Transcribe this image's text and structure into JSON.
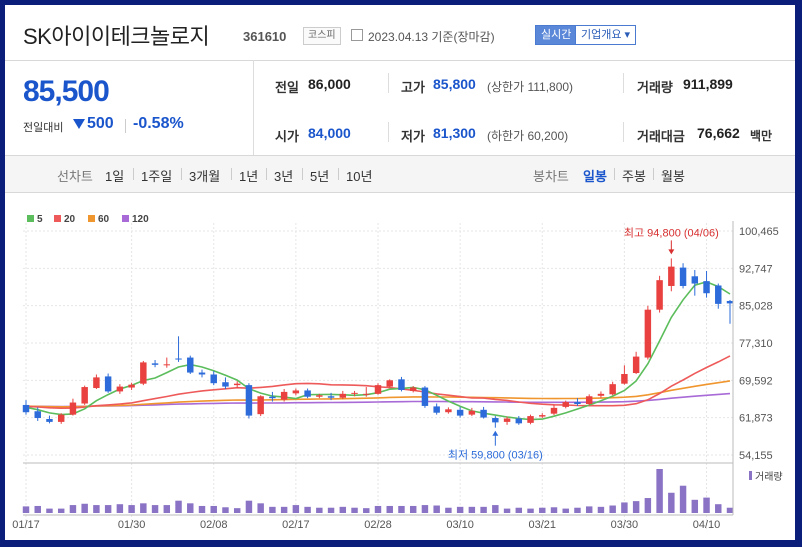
{
  "header": {
    "name": "SK아이이테크놀로지",
    "code": "361610",
    "market_badge": "코스피",
    "date": "2023.04.13 기준(장마감)",
    "realtime_button": "실시간",
    "company_button": "기업개요",
    "company_button_arrow": "▾"
  },
  "quote": {
    "price": "85,500",
    "change_label": "전일대비",
    "change": "500",
    "change_pct": "-0.58%",
    "prev_label": "전일",
    "prev": "86,000",
    "open_label": "시가",
    "open": "84,000",
    "high_label": "고가",
    "high": "85,800",
    "upper_limit": "(상한가 111,800)",
    "low_label": "저가",
    "low": "81,300",
    "lower_limit": "(하한가 60,200)",
    "volume_label": "거래량",
    "volume": "911,899",
    "amount_label": "거래대금",
    "amount": "76,662",
    "amount_unit": "백만"
  },
  "tabs": {
    "line_chart": "선차트",
    "periods": [
      "1일",
      "1주일",
      "3개월",
      "1년",
      "3년",
      "5년",
      "10년"
    ],
    "candle_chart": "봉차트",
    "candle_periods": [
      "일봉",
      "주봉",
      "월봉"
    ],
    "active_candle": "일봉"
  },
  "colors": {
    "up": "#e8413f",
    "down": "#2c6bd9",
    "ma5": "#5bbd5b",
    "ma20": "#ee5a5a",
    "ma60": "#f0962e",
    "ma120": "#a86ad6",
    "volume": "#8a72c4"
  },
  "chart_data": {
    "type": "candlestick",
    "legend": [
      {
        "name": "5",
        "color": "#5bbd5b"
      },
      {
        "name": "20",
        "color": "#ee5a5a"
      },
      {
        "name": "60",
        "color": "#f0962e"
      },
      {
        "name": "120",
        "color": "#a86ad6"
      }
    ],
    "y_ticks": [
      "100,465",
      "92,747",
      "85,028",
      "77,310",
      "69,592",
      "61,873",
      "54,155"
    ],
    "ylim": [
      54155,
      100465
    ],
    "x_ticks": [
      {
        "i": 0,
        "label": "01/17"
      },
      {
        "i": 9,
        "label": "01/30"
      },
      {
        "i": 16,
        "label": "02/08"
      },
      {
        "i": 23,
        "label": "02/17"
      },
      {
        "i": 30,
        "label": "02/28"
      },
      {
        "i": 37,
        "label": "03/10"
      },
      {
        "i": 44,
        "label": "03/21"
      },
      {
        "i": 51,
        "label": "03/30"
      },
      {
        "i": 58,
        "label": "04/10"
      }
    ],
    "annotations": {
      "high": "최고 94,800 (04/06)",
      "high_index": 55,
      "high_value": 94800,
      "low": "최저 59,800 (03/16)",
      "low_index": 40,
      "low_value": 59800
    },
    "volume_label": "거래량",
    "candles": [
      {
        "o": 64500,
        "h": 65500,
        "c": 63000,
        "l": 62500
      },
      {
        "o": 63200,
        "h": 64000,
        "c": 61800,
        "l": 61200
      },
      {
        "o": 61600,
        "h": 62300,
        "c": 61000,
        "l": 60700
      },
      {
        "o": 61000,
        "h": 62800,
        "c": 62500,
        "l": 60600
      },
      {
        "o": 62500,
        "h": 65800,
        "c": 65000,
        "l": 62300
      },
      {
        "o": 64800,
        "h": 68500,
        "c": 68200,
        "l": 64500
      },
      {
        "o": 68000,
        "h": 70800,
        "c": 70200,
        "l": 67800
      },
      {
        "o": 70400,
        "h": 71000,
        "c": 67300,
        "l": 67000
      },
      {
        "o": 67300,
        "h": 68800,
        "c": 68300,
        "l": 66800
      },
      {
        "o": 68100,
        "h": 69100,
        "c": 68700,
        "l": 67600
      },
      {
        "o": 68900,
        "h": 73600,
        "c": 73300,
        "l": 68600
      },
      {
        "o": 73100,
        "h": 73800,
        "c": 72800,
        "l": 72300
      },
      {
        "o": 72700,
        "h": 74300,
        "c": 72900,
        "l": 72200
      },
      {
        "o": 74100,
        "h": 78700,
        "c": 74000,
        "l": 73400
      },
      {
        "o": 74300,
        "h": 74700,
        "c": 71200,
        "l": 70900
      },
      {
        "o": 71200,
        "h": 71800,
        "c": 70800,
        "l": 70200
      },
      {
        "o": 70800,
        "h": 71500,
        "c": 69000,
        "l": 68600
      },
      {
        "o": 69200,
        "h": 70200,
        "c": 68300,
        "l": 67800
      },
      {
        "o": 68600,
        "h": 69400,
        "c": 68900,
        "l": 68000
      },
      {
        "o": 68600,
        "h": 69000,
        "c": 62300,
        "l": 61700
      },
      {
        "o": 62600,
        "h": 66500,
        "c": 66300,
        "l": 62200
      },
      {
        "o": 66200,
        "h": 67200,
        "c": 65900,
        "l": 65200
      },
      {
        "o": 65600,
        "h": 67800,
        "c": 67200,
        "l": 65200
      },
      {
        "o": 66900,
        "h": 67900,
        "c": 67500,
        "l": 66500
      },
      {
        "o": 67500,
        "h": 67900,
        "c": 66200,
        "l": 65900
      },
      {
        "o": 66200,
        "h": 66800,
        "c": 66500,
        "l": 65900
      },
      {
        "o": 66300,
        "h": 67000,
        "c": 66000,
        "l": 65500
      },
      {
        "o": 66000,
        "h": 67400,
        "c": 66800,
        "l": 65700
      },
      {
        "o": 66800,
        "h": 67400,
        "c": 67000,
        "l": 66300
      },
      {
        "o": 66800,
        "h": 68200,
        "c": 66800,
        "l": 66200
      },
      {
        "o": 66800,
        "h": 69000,
        "c": 68600,
        "l": 66600
      },
      {
        "o": 68300,
        "h": 69800,
        "c": 69600,
        "l": 68100
      },
      {
        "o": 69800,
        "h": 70300,
        "c": 67600,
        "l": 67300
      },
      {
        "o": 67400,
        "h": 68400,
        "c": 68100,
        "l": 67100
      },
      {
        "o": 68100,
        "h": 68400,
        "c": 64300,
        "l": 63900
      },
      {
        "o": 64200,
        "h": 64800,
        "c": 62900,
        "l": 62500
      },
      {
        "o": 63000,
        "h": 64000,
        "c": 63600,
        "l": 62700
      },
      {
        "o": 63500,
        "h": 64100,
        "c": 62300,
        "l": 61900
      },
      {
        "o": 62500,
        "h": 63900,
        "c": 63300,
        "l": 62200
      },
      {
        "o": 63500,
        "h": 64100,
        "c": 61900,
        "l": 61700
      },
      {
        "o": 61800,
        "h": 62200,
        "c": 60900,
        "l": 59800
      },
      {
        "o": 61000,
        "h": 62100,
        "c": 61700,
        "l": 60400
      },
      {
        "o": 61700,
        "h": 62200,
        "c": 60700,
        "l": 60400
      },
      {
        "o": 60800,
        "h": 62500,
        "c": 62200,
        "l": 60500
      },
      {
        "o": 62100,
        "h": 62800,
        "c": 62400,
        "l": 61800
      },
      {
        "o": 62700,
        "h": 64600,
        "c": 63900,
        "l": 62400
      },
      {
        "o": 64100,
        "h": 65400,
        "c": 65100,
        "l": 63800
      },
      {
        "o": 65100,
        "h": 65900,
        "c": 64700,
        "l": 64300
      },
      {
        "o": 64700,
        "h": 66700,
        "c": 66300,
        "l": 64400
      },
      {
        "o": 66400,
        "h": 67300,
        "c": 66800,
        "l": 66000
      },
      {
        "o": 66700,
        "h": 69300,
        "c": 68800,
        "l": 66500
      },
      {
        "o": 68900,
        "h": 72700,
        "c": 70900,
        "l": 68700
      },
      {
        "o": 71100,
        "h": 75500,
        "c": 74500,
        "l": 70900
      },
      {
        "o": 74300,
        "h": 85000,
        "c": 84200,
        "l": 73900
      },
      {
        "o": 84200,
        "h": 91200,
        "c": 90300,
        "l": 83600
      },
      {
        "o": 89100,
        "h": 94800,
        "c": 93100,
        "l": 88000
      },
      {
        "o": 92900,
        "h": 93800,
        "c": 89100,
        "l": 88600
      },
      {
        "o": 91100,
        "h": 92400,
        "c": 89600,
        "l": 87100
      },
      {
        "o": 90100,
        "h": 92200,
        "c": 87600,
        "l": 86700
      },
      {
        "o": 89200,
        "h": 89600,
        "c": 85400,
        "l": 84400
      },
      {
        "o": 86000,
        "h": 86200,
        "c": 85500,
        "l": 81300
      }
    ],
    "volumes": [
      1.5,
      1.6,
      1.0,
      1.0,
      1.8,
      2.1,
      1.8,
      1.8,
      2.0,
      1.8,
      2.2,
      1.8,
      1.8,
      2.8,
      2.2,
      1.6,
      1.6,
      1.3,
      1.1,
      2.8,
      2.2,
      1.4,
      1.4,
      1.8,
      1.4,
      1.2,
      1.2,
      1.4,
      1.2,
      1.1,
      1.6,
      1.6,
      1.6,
      1.6,
      1.8,
      1.7,
      1.2,
      1.4,
      1.4,
      1.4,
      1.8,
      1.0,
      1.2,
      1.0,
      1.2,
      1.3,
      1.0,
      1.2,
      1.5,
      1.4,
      1.7,
      2.4,
      2.7,
      3.4,
      10.0,
      4.6,
      6.2,
      3.0,
      3.5,
      2.0,
      1.2
    ]
  }
}
